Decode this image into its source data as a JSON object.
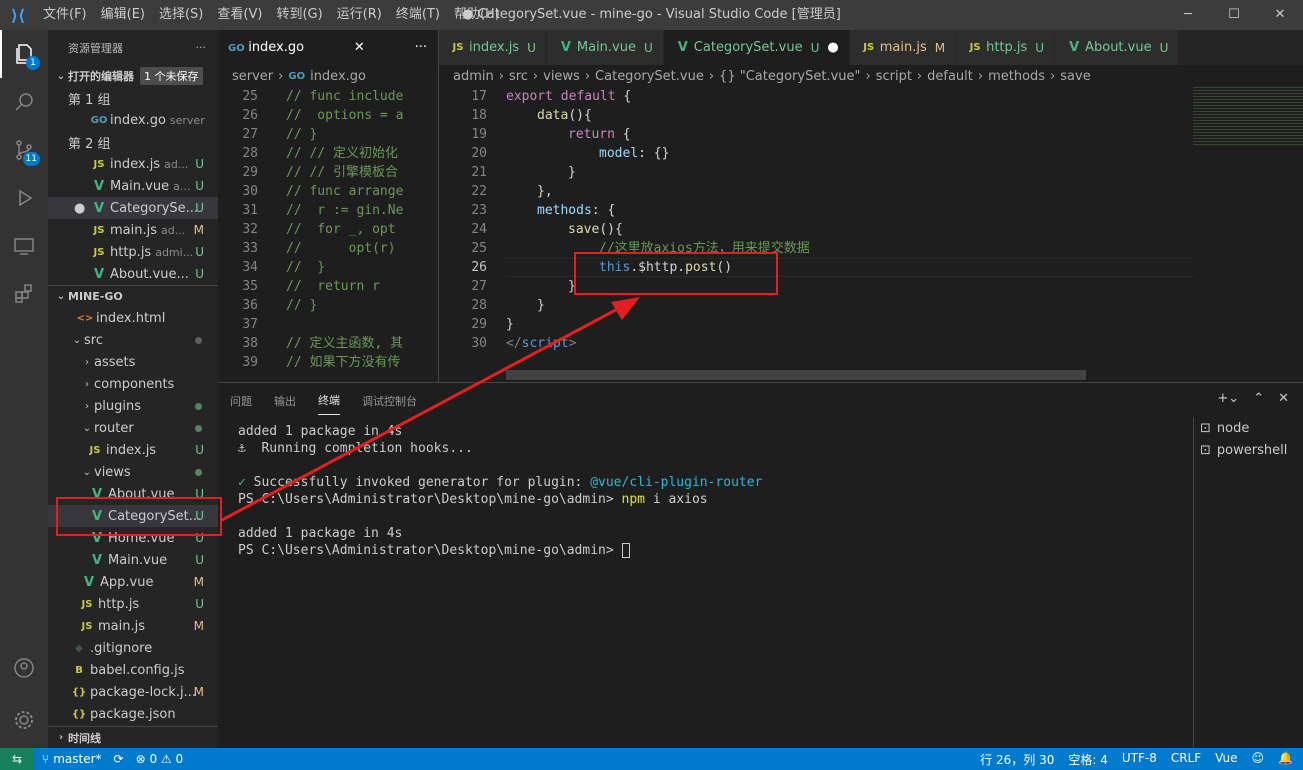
{
  "titlebar": {
    "menus": [
      "文件(F)",
      "编辑(E)",
      "选择(S)",
      "查看(V)",
      "转到(G)",
      "运行(R)",
      "终端(T)",
      "帮助(H)"
    ],
    "title": "● CategorySet.vue - mine-go - Visual Studio Code [管理员]"
  },
  "activity": {
    "explorer_badge": "1",
    "scm_badge": "11"
  },
  "sidebar": {
    "header": "资源管理器",
    "open_editors": "打开的编辑器",
    "unsaved": "1 个未保存",
    "group1": "第 1 组",
    "group2": "第 2 组",
    "g1": [
      {
        "name": "index.go",
        "sub": "server"
      }
    ],
    "g2": [
      {
        "name": "index.js",
        "sub": "ad...",
        "st": "U"
      },
      {
        "name": "Main.vue",
        "sub": "a...",
        "st": "U"
      },
      {
        "name": "CategorySe...",
        "sub": "",
        "st": "U"
      },
      {
        "name": "main.js",
        "sub": "ad...",
        "st": "M"
      },
      {
        "name": "http.js",
        "sub": "admi...",
        "st": "U"
      },
      {
        "name": "About.vue...",
        "sub": "",
        "st": "U"
      }
    ],
    "project": "MINE-GO",
    "tree": [
      "index.html",
      "src",
      "assets",
      "components",
      "plugins",
      "router",
      "index.js",
      "views",
      "About.vue",
      "CategorySet...",
      "Home.vue",
      "Main.vue",
      "App.vue",
      "http.js",
      "main.js",
      ".gitignore",
      "babel.config.js",
      "package-lock.j...",
      "package.json"
    ],
    "tree_status": {
      "index.js": "U",
      "About.vue": "U",
      "CategorySet...": "U",
      "Home.vue": "U",
      "Main.vue": "U",
      "App.vue": "M",
      "http.js": "U",
      "main.js": "M",
      "package-lock.j...": "M"
    },
    "timeline": "时间线"
  },
  "editor1": {
    "tab": "index.go",
    "crumb1": "server",
    "crumb2": "index.go",
    "lines": [
      [
        "25",
        "// func include"
      ],
      [
        "26",
        "//  options = a"
      ],
      [
        "27",
        "// }"
      ],
      [
        "28",
        "// // 定义初始化"
      ],
      [
        "29",
        "// // 引擎模板合"
      ],
      [
        "30",
        "// func arrange"
      ],
      [
        "31",
        "//  r := gin.Ne"
      ],
      [
        "32",
        "//  for _, opt"
      ],
      [
        "33",
        "//      opt(r)"
      ],
      [
        "34",
        "//  }"
      ],
      [
        "35",
        "//  return r"
      ],
      [
        "36",
        "// }"
      ],
      [
        "37",
        ""
      ],
      [
        "38",
        "// 定义主函数, 其"
      ],
      [
        "39",
        "// 如果下方没有传"
      ]
    ]
  },
  "editor2": {
    "tabs": [
      {
        "name": "index.js",
        "st": "U"
      },
      {
        "name": "Main.vue",
        "st": "U"
      },
      {
        "name": "CategorySet.vue",
        "st": "U"
      },
      {
        "name": "main.js",
        "st": "M"
      },
      {
        "name": "http.js",
        "st": "U"
      },
      {
        "name": "About.vue",
        "st": "U"
      }
    ],
    "breadcrumb": [
      "admin",
      "src",
      "views",
      "CategorySet.vue",
      "{} \"CategorySet.vue\"",
      "script",
      "default",
      "methods",
      "save"
    ],
    "lines": [
      "17",
      "18",
      "19",
      "20",
      "21",
      "22",
      "23",
      "24",
      "25",
      "26",
      "27",
      "28",
      "29",
      "30"
    ],
    "code": {
      "l17a": "export",
      "l17b": "default",
      "l17c": "{",
      "l18a": "data",
      "l18b": "(){",
      "l19a": "return",
      "l19b": "{",
      "l20a": "model",
      "l20b": ": {}",
      "l21": "}",
      "l22": "},",
      "l23a": "methods",
      "l23b": ": {",
      "l24a": "save",
      "l24b": "(){",
      "l25": "//这里放axios方法，用来提交数据",
      "l26a": "this",
      "l26b": ".$http.",
      "l26c": "post",
      "l26d": "()",
      "l27": "}",
      "l28": "}",
      "l29": "}",
      "l30a": "</",
      "l30b": "script",
      "l30c": ">"
    }
  },
  "panel": {
    "tabs": [
      "问题",
      "输出",
      "终端",
      "调试控制台"
    ],
    "active": "终端",
    "terminal": {
      "t1": "added 1 package in 4s",
      "t2": "⚓  Running completion hooks...",
      "t3a": "✓",
      "t3b": " Successfully invoked generator for plugin: ",
      "t3c": "@vue/cli-plugin-router",
      "t4a": "PS C:\\Users\\Administrator\\Desktop\\mine-go\\admin> ",
      "t4b": "npm",
      "t4c": " i axios",
      "t5": "added 1 package in 4s",
      "t6": "PS C:\\Users\\Administrator\\Desktop\\mine-go\\admin> "
    },
    "shells": [
      "node",
      "powershell"
    ]
  },
  "status": {
    "branch": "master*",
    "problems": "⊗ 0 ⚠ 0",
    "position": "行 26，列 30",
    "spaces": "空格: 4",
    "encoding": "UTF-8",
    "eol": "CRLF",
    "lang": "Vue"
  },
  "annotation_color": "#e51f1f"
}
